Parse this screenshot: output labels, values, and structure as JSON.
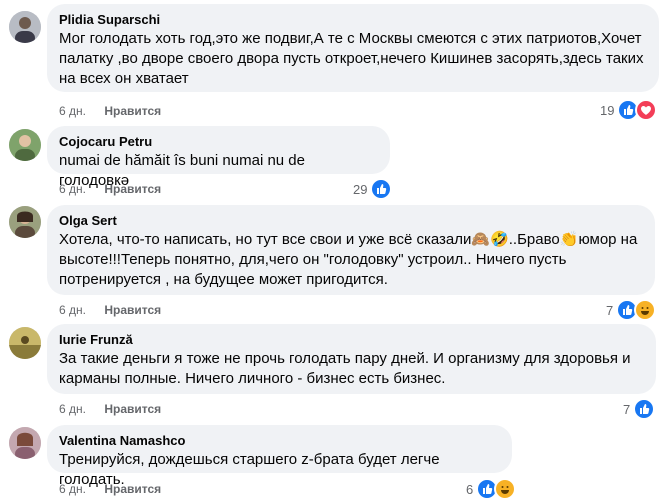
{
  "comments": [
    {
      "author": "Plidia Suparschi",
      "text": "Мог голодать хоть год,это же подвиг,А те с Москвы смеются с этих патриотов,Хочет\nпалатку ,во дворе своего двора пусть откроет,нечего Кишинев засорять,здесь таких\nна всех он хватает",
      "time": "6 дн.",
      "like_label": "Нравится",
      "reaction_count": "19",
      "reactions": [
        "like-icon",
        "love-icon"
      ]
    },
    {
      "author": "Cojocaru Petru",
      "text": "numai de hămăit îs buni numai nu de голодовкә",
      "time": "6 дн.",
      "like_label": "Нравится",
      "reaction_count": "29",
      "reactions": [
        "like-icon"
      ]
    },
    {
      "author": "Olga Sert",
      "text": "Хотела, что-то написать, но тут все свои и уже всё сказали🙈🤣..Браво👏юмор на\nвысоте!!!Теперь понятно, для,чего он \"голодовку\" устроил.. Ничего пусть\nпотренируется , на будущее может пригодится.",
      "time": "6 дн.",
      "like_label": "Нравится",
      "reaction_count": "7",
      "reactions": [
        "like-icon",
        "haha-icon"
      ]
    },
    {
      "author": "Iurie Frunză",
      "text": "За такие деньги я тоже не прочь голодать пару дней. И организму для здоровья и\nкарманы полные. Ничего личного - бизнес есть бизнес.",
      "time": "6 дн.",
      "like_label": "Нравится",
      "reaction_count": "7",
      "reactions": [
        "like-icon"
      ]
    },
    {
      "author": "Valentina Namashco",
      "text": "Тренируйся, дождешься старшего z-брата будет легче голодать.",
      "time": "6 дн.",
      "like_label": "Нравится",
      "reaction_count": "6",
      "reactions": [
        "like-icon",
        "haha-icon"
      ]
    }
  ]
}
